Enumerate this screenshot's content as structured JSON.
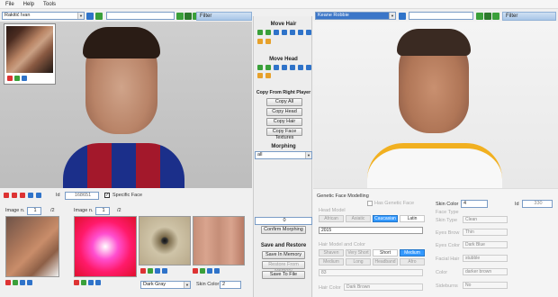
{
  "menu": [
    "File",
    "Help",
    "Tools"
  ],
  "left_player": {
    "name": "Rakitić Ivan",
    "filter_label": "Filter"
  },
  "right_player": {
    "name": "Keane Robbie",
    "filter_label": "Filter"
  },
  "move_hair": {
    "title": "Move Hair"
  },
  "move_head": {
    "title": "Move Head"
  },
  "copy_from_right": {
    "title": "Copy From Right Player",
    "buttons": [
      "Copy All",
      "Copy Head",
      "Copy Hair",
      "Copy Face Textures"
    ]
  },
  "morphing": {
    "title": "Morphing",
    "value": "all",
    "amount": "0",
    "confirm": "Confirm Morphing"
  },
  "save_restore": {
    "title": "Save and Restore",
    "buttons": [
      "Save In Memory",
      "Restore From Memory",
      "Save To File"
    ]
  },
  "left_bottom": {
    "id_label": "Id",
    "id_value": "168651",
    "specific_face": "Specific Face",
    "image_n_label": "Image n.",
    "image_a_value": "1",
    "image_a_total": "/2",
    "image_b_value": "1",
    "image_b_total": "/2",
    "color_select": "Dark Gray",
    "skin_color_label": "Skin Color",
    "skin_color_value": "2"
  },
  "genetic": {
    "title": "Genetic Face Modelling",
    "has_genetic": "Has Genetic Face",
    "head_model": "Head Model",
    "races": [
      "African",
      "Asiatic",
      "Caucasian",
      "Latin"
    ],
    "race_selected": "Caucasian",
    "head_model_value": "2015",
    "hair_model_color": "Hair Model and Color",
    "hair_row1": [
      "Shaven",
      "Very Short",
      "Short",
      "Medium"
    ],
    "hair_row2": [
      "Medium",
      "Long",
      "Headband",
      "Afro"
    ],
    "hair_selected": "Medium",
    "hair_white": "Short",
    "hair_value": "83",
    "hair_color_label": "Hair Color",
    "hair_color_value": "Dark Brown"
  },
  "right_side": {
    "skin_color_label": "Skin Color",
    "skin_color_value": "4",
    "id_label": "Id",
    "id_value": "330",
    "face_type": "Face Type",
    "fields": [
      {
        "label": "Skin Type",
        "value": "Clean"
      },
      {
        "label": "Eyes Brow",
        "value": "Thin"
      },
      {
        "label": "Eyes Color",
        "value": "Dark Blue"
      },
      {
        "label": "Facial Hair",
        "value": "stubble"
      },
      {
        "label": "Color",
        "value": "darker brown"
      },
      {
        "label": "Sideburns",
        "value": "No"
      }
    ]
  }
}
